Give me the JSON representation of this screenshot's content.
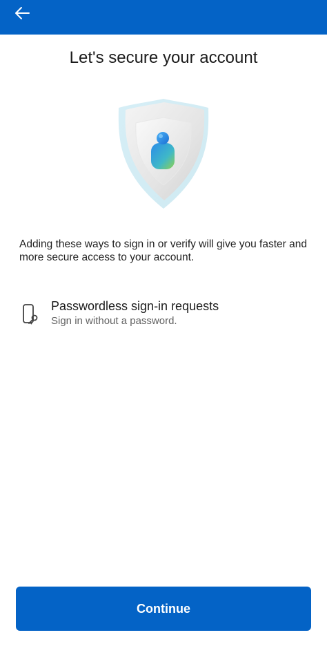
{
  "header": {
    "back_icon": "arrow-left-icon",
    "background_color": "#0463c6"
  },
  "page": {
    "title": "Let's secure your account",
    "description": "Adding these ways to sign in or verify will give you faster and more secure access to your account.",
    "hero_icon": "shield-user-illustration"
  },
  "methods": [
    {
      "icon": "phone-key-icon",
      "title": "Passwordless sign-in requests",
      "subtitle": "Sign in without a password."
    }
  ],
  "footer": {
    "continue_label": "Continue",
    "accent_color": "#0463c6"
  }
}
